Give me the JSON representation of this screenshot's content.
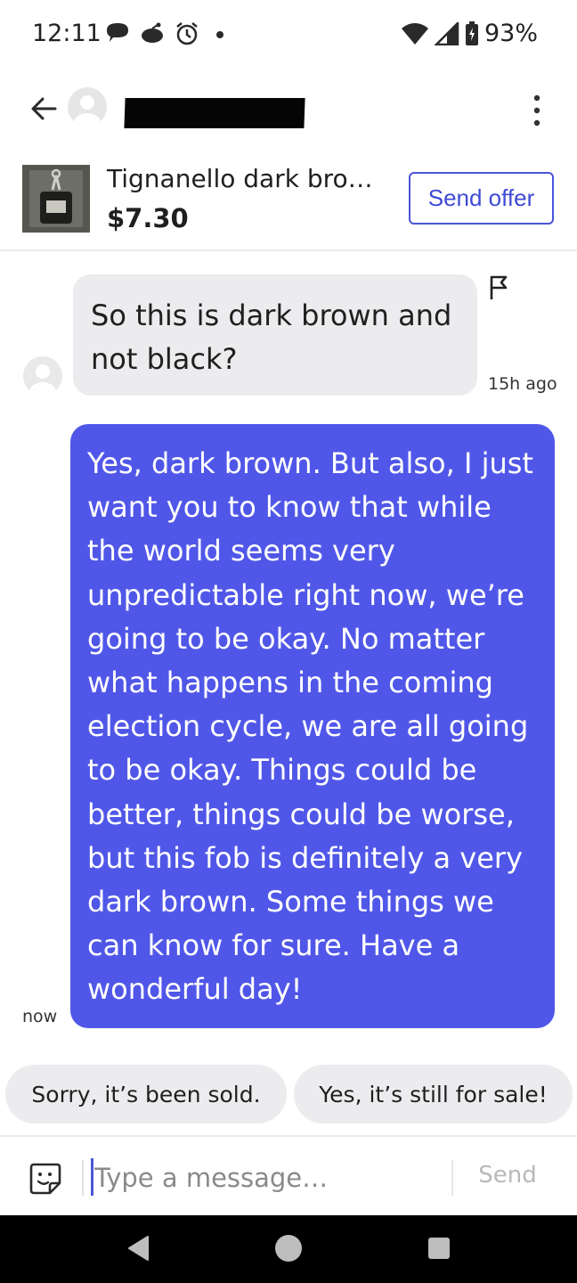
{
  "status_bar": {
    "time": "12:11",
    "battery": "93%",
    "icons": [
      "chat-bubble-icon",
      "reddit-icon",
      "alarm-icon",
      "dot-icon",
      "wifi-icon",
      "signal-icon",
      "battery-icon"
    ]
  },
  "header": {
    "back_icon": "arrow-left-icon",
    "avatar_icon": "person-icon",
    "contact_name": "",
    "menu_icon": "more-vertical-icon"
  },
  "listing": {
    "title": "Tignanello dark bro…",
    "price": "$7.30",
    "send_offer_label": "Send offer"
  },
  "messages": [
    {
      "direction": "incoming",
      "text": "So this is dark brown and not black?",
      "time": "15h ago"
    },
    {
      "direction": "outgoing",
      "text": "Yes, dark brown. But also, I just want you to know that while the world seems very unpredictable right now, we’re going to be okay. No matter what happens in the coming election cycle, we are all going to be okay. Things could be better, things could be worse, but this fob is definitely a very dark brown. Some things we can know for sure. Have a wonderful day!",
      "time": "now"
    }
  ],
  "quick_replies": [
    "Sorry, it’s been sold.",
    "Yes, it’s still for sale!"
  ],
  "composer": {
    "placeholder": "Type a message…",
    "send_label": "Send",
    "sticker_icon": "sticker-icon"
  },
  "nav_bar": {
    "icons": [
      "nav-back-icon",
      "nav-home-icon",
      "nav-recents-icon"
    ]
  },
  "colors": {
    "accent": "#5057e8",
    "bubble_incoming": "#ececef",
    "text": "#1f1f1f"
  }
}
